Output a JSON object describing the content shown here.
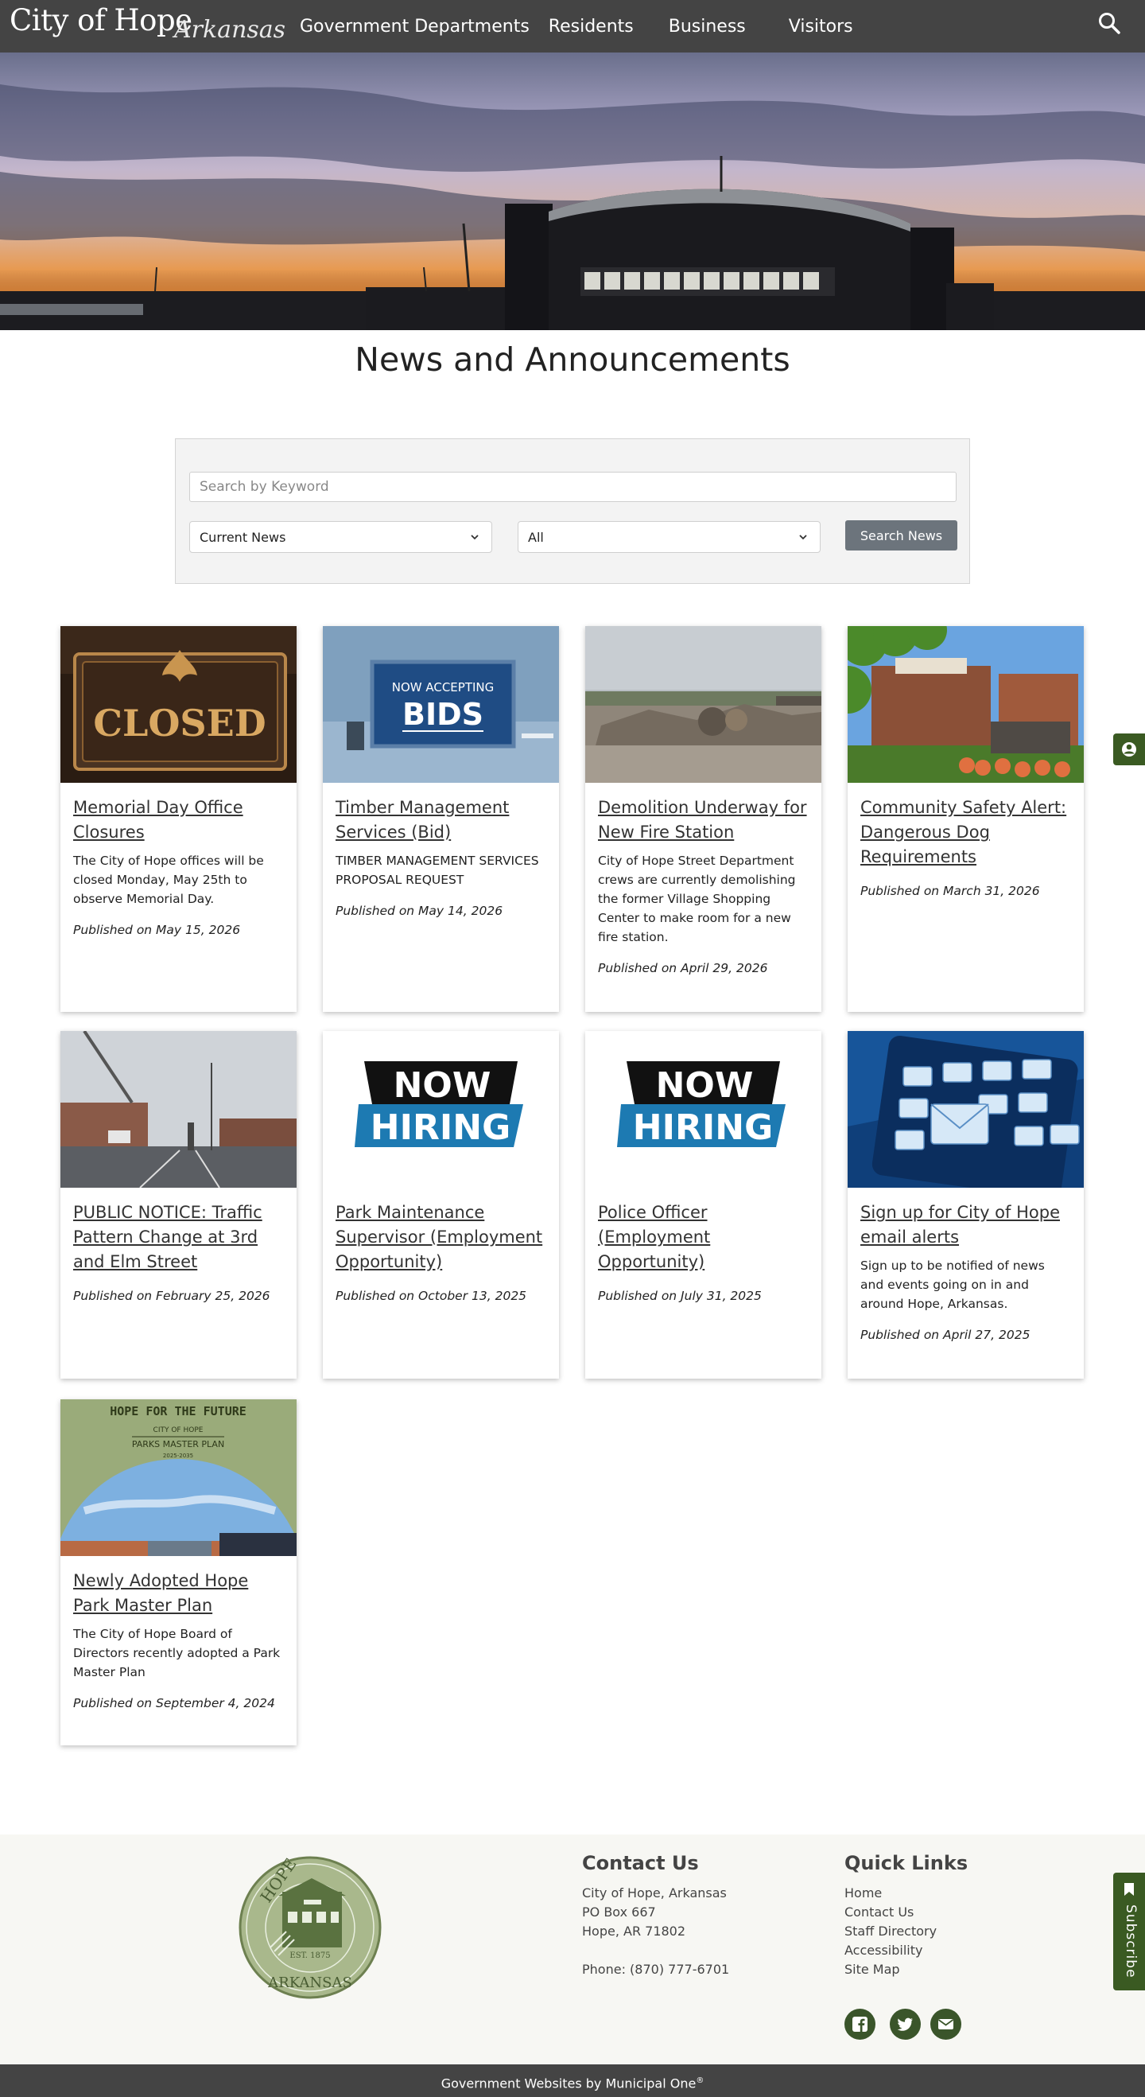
{
  "header": {
    "logo_main": "City of Hope",
    "logo_script": "Arkansas",
    "nav": [
      "Government Departments",
      "Residents",
      "Business",
      "Visitors"
    ]
  },
  "page": {
    "title": "News and Announcements"
  },
  "search": {
    "keyword_placeholder": "Search by Keyword",
    "news_type_selected": "Current News",
    "category_selected": "All",
    "button_label": "Search News"
  },
  "cards": [
    {
      "image": "closed-sign",
      "title": "Memorial Day Office Closures",
      "desc": "The City of Hope offices will be closed Monday, May 25th to observe Memorial Day.",
      "published": "Published on May 15, 2026",
      "image_text": "CLOSED"
    },
    {
      "image": "now-accepting-bids",
      "title": "Timber Management Services (Bid)",
      "desc": "TIMBER MANAGEMENT SERVICES PROPOSAL REQUEST",
      "published": "Published on May 14, 2026",
      "image_text_small": "NOW ACCEPTING",
      "image_text_large": "BIDS"
    },
    {
      "image": "demolition-site",
      "title": "Demolition Underway for New Fire Station",
      "desc": "City of Hope Street Department crews are currently demolishing the former Village Shopping Center to make room for a new fire station.",
      "published": "Published on April 29, 2026"
    },
    {
      "image": "downtown-hope",
      "title": "Community Safety Alert: Dangerous Dog Requirements",
      "desc": "",
      "published": "Published on March 31, 2026"
    },
    {
      "image": "traffic-intersection",
      "title": "PUBLIC NOTICE: Traffic Pattern Change at 3rd and Elm Street",
      "desc": "",
      "published": "Published on February 25, 2026"
    },
    {
      "image": "now-hiring",
      "title": "Park Maintenance Supervisor (Employment Opportunity)",
      "desc": "",
      "published": "Published on October 13, 2025",
      "image_text_top": "NOW",
      "image_text_bottom": "HIRING"
    },
    {
      "image": "now-hiring",
      "title": "Police Officer (Employment Opportunity)",
      "desc": "",
      "published": "Published on July 31, 2025",
      "image_text_top": "NOW",
      "image_text_bottom": "HIRING"
    },
    {
      "image": "email-alerts",
      "title": "Sign up for City of Hope email alerts",
      "desc": "Sign up to be notified of news and events going on in and around Hope, Arkansas.",
      "published": "Published on April 27, 2025"
    },
    {
      "image": "parks-master-plan",
      "title": "Newly Adopted Hope Park Master Plan",
      "desc": "The City of Hope Board of Directors recently adopted a Park Master Plan",
      "published": "Published on September 4, 2024",
      "image_text_1": "HOPE FOR THE FUTURE",
      "image_text_2": "CITY OF HOPE",
      "image_text_3": "PARKS MASTER PLAN",
      "image_text_4": "2025-2035"
    }
  ],
  "footer": {
    "seal_top": "HOPE",
    "seal_bottom": "ARKANSAS",
    "seal_est": "EST. 1875",
    "contact_heading": "Contact Us",
    "contact_lines": [
      "City of Hope, Arkansas",
      "PO Box 667",
      "Hope, AR 71802"
    ],
    "phone": "Phone: (870) 777-6701",
    "quick_heading": "Quick Links",
    "quick_links": [
      "Home",
      "Contact Us",
      "Staff Directory",
      "Accessibility",
      "Site Map"
    ],
    "social": [
      "facebook-icon",
      "twitter-icon",
      "email-icon"
    ]
  },
  "bottom": {
    "credit": "Government Websites by Municipal One",
    "reg": "®"
  },
  "side": {
    "subscribe_label": "Subscribe"
  },
  "colors": {
    "header_bg": "#444444",
    "accent_green": "#3a5a22",
    "search_button": "#6c747c"
  }
}
